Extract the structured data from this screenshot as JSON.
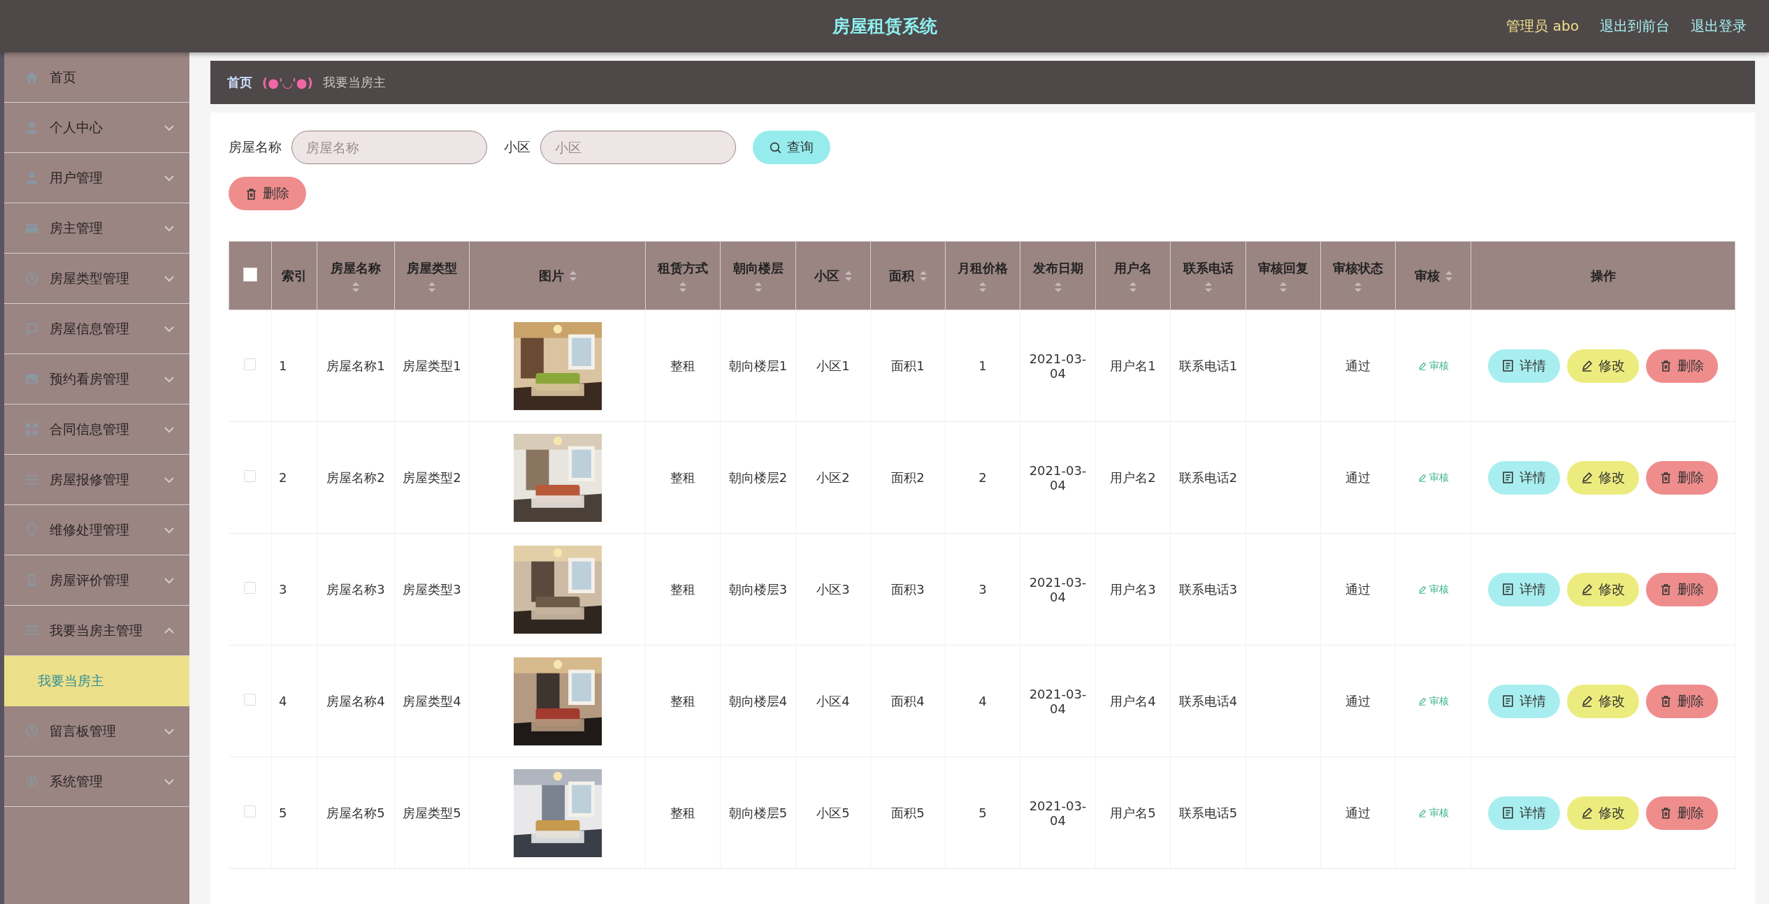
{
  "header": {
    "title": "房屋租赁系统",
    "user": "管理员 abo",
    "links": [
      "退出到前台",
      "退出登录"
    ]
  },
  "sidebar": {
    "items": [
      {
        "label": "首页",
        "kind": "link"
      },
      {
        "label": "个人中心",
        "kind": "menu",
        "expanded": false
      },
      {
        "label": "用户管理",
        "kind": "menu",
        "expanded": false
      },
      {
        "label": "房主管理",
        "kind": "menu",
        "expanded": false
      },
      {
        "label": "房屋类型管理",
        "kind": "menu",
        "expanded": false
      },
      {
        "label": "房屋信息管理",
        "kind": "menu",
        "expanded": false
      },
      {
        "label": "预约看房管理",
        "kind": "menu",
        "expanded": false
      },
      {
        "label": "合同信息管理",
        "kind": "menu",
        "expanded": false
      },
      {
        "label": "房屋报修管理",
        "kind": "menu",
        "expanded": false
      },
      {
        "label": "维修处理管理",
        "kind": "menu",
        "expanded": false
      },
      {
        "label": "房屋评价管理",
        "kind": "menu",
        "expanded": false
      },
      {
        "label": "我要当房主管理",
        "kind": "menu",
        "expanded": true,
        "children": [
          {
            "label": "我要当房主",
            "selected": true
          }
        ]
      },
      {
        "label": "留言板管理",
        "kind": "menu",
        "expanded": false
      },
      {
        "label": "系统管理",
        "kind": "menu",
        "expanded": false
      }
    ]
  },
  "breadcrumb": {
    "home": "首页",
    "emoticon": "(●'◡'●)",
    "current": "我要当房主"
  },
  "search": {
    "fields": [
      {
        "label": "房屋名称",
        "placeholder": "房屋名称"
      },
      {
        "label": "小区",
        "placeholder": "小区"
      }
    ],
    "button": "查询"
  },
  "delete_button": "删除",
  "table": {
    "all_checked": false,
    "columns": [
      {
        "label": "索引",
        "sortable": false
      },
      {
        "label": "房屋名称",
        "sortable": true
      },
      {
        "label": "房屋类型",
        "sortable": true
      },
      {
        "label": "图片",
        "sortable": true
      },
      {
        "label": "租赁方式",
        "sortable": true
      },
      {
        "label": "朝向楼层",
        "sortable": true
      },
      {
        "label": "小区",
        "sortable": true
      },
      {
        "label": "面积",
        "sortable": true
      },
      {
        "label": "月租价格",
        "sortable": true
      },
      {
        "label": "发布日期",
        "sortable": true
      },
      {
        "label": "用户名",
        "sortable": true
      },
      {
        "label": "联系电话",
        "sortable": true
      },
      {
        "label": "审核回复",
        "sortable": true
      },
      {
        "label": "审核状态",
        "sortable": true
      },
      {
        "label": "审核",
        "sortable": true
      },
      {
        "label": "操作",
        "sortable": false
      }
    ],
    "rows": [
      {
        "checked": false,
        "cells": [
          "1",
          "房屋名称1",
          "房屋类型1",
          null,
          "整租",
          "朝向楼层1",
          "小区1",
          "面积1",
          "1",
          "2021-03-04",
          "用户名1",
          "联系电话1",
          "",
          "通过"
        ],
        "audit": "审核",
        "actions": [
          "详情",
          "修改",
          "删除"
        ]
      },
      {
        "checked": false,
        "cells": [
          "2",
          "房屋名称2",
          "房屋类型2",
          null,
          "整租",
          "朝向楼层2",
          "小区2",
          "面积2",
          "2",
          "2021-03-04",
          "用户名2",
          "联系电话2",
          "",
          "通过"
        ],
        "audit": "审核",
        "actions": [
          "详情",
          "修改",
          "删除"
        ]
      },
      {
        "checked": false,
        "cells": [
          "3",
          "房屋名称3",
          "房屋类型3",
          null,
          "整租",
          "朝向楼层3",
          "小区3",
          "面积3",
          "3",
          "2021-03-04",
          "用户名3",
          "联系电话3",
          "",
          "通过"
        ],
        "audit": "审核",
        "actions": [
          "详情",
          "修改",
          "删除"
        ]
      },
      {
        "checked": false,
        "cells": [
          "4",
          "房屋名称4",
          "房屋类型4",
          null,
          "整租",
          "朝向楼层4",
          "小区4",
          "面积4",
          "4",
          "2021-03-04",
          "用户名4",
          "联系电话4",
          "",
          "通过"
        ],
        "audit": "审核",
        "actions": [
          "详情",
          "修改",
          "删除"
        ]
      },
      {
        "checked": false,
        "cells": [
          "5",
          "房屋名称5",
          "房屋类型5",
          null,
          "整租",
          "朝向楼层5",
          "小区5",
          "面积5",
          "5",
          "2021-03-04",
          "用户名5",
          "联系电话5",
          "",
          "通过"
        ],
        "audit": "审核",
        "actions": [
          "详情",
          "修改",
          "删除"
        ]
      }
    ]
  }
}
